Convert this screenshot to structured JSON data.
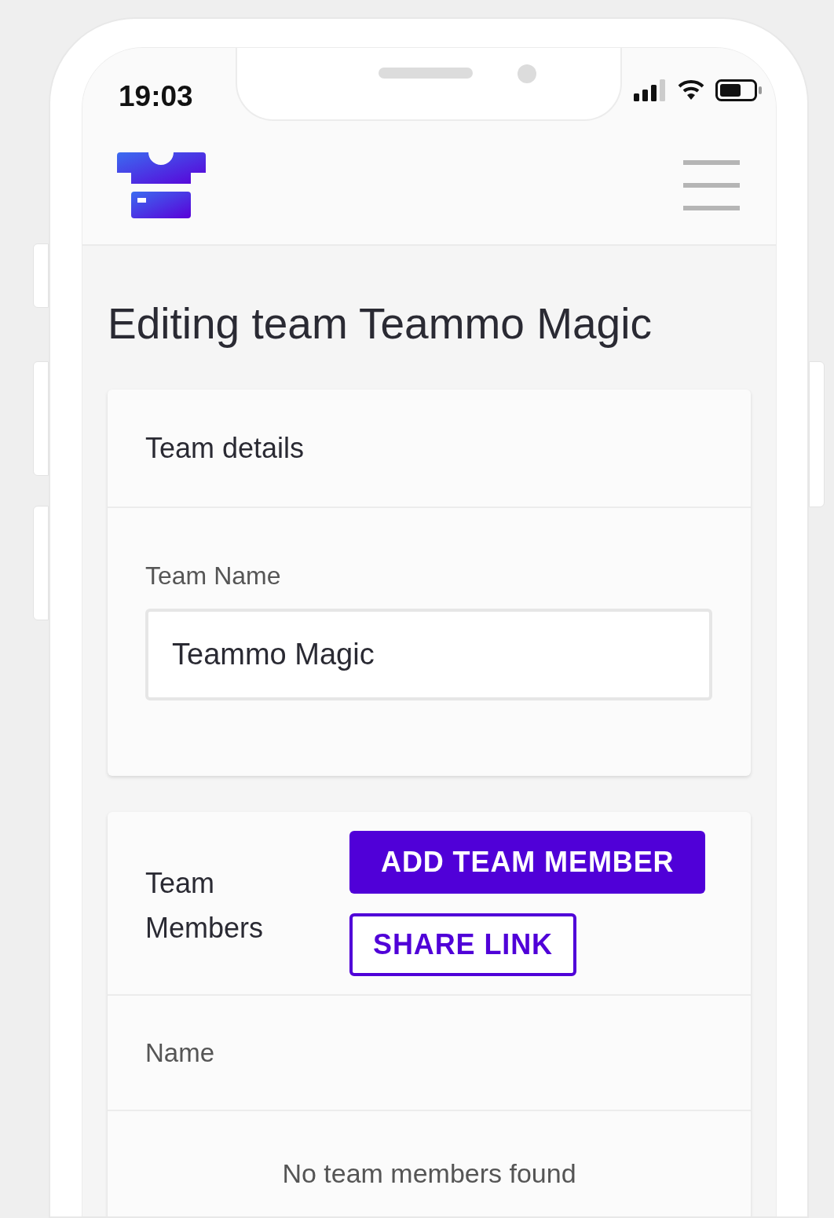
{
  "status_bar": {
    "time": "19:03"
  },
  "page_title": "Editing team Teammo Magic",
  "team_details": {
    "title": "Team details",
    "field": {
      "label": "Team Name",
      "value": "Teammo Magic"
    }
  },
  "team_members": {
    "title": "Team Members",
    "buttons": [
      {
        "label": "ADD TEAM MEMBER",
        "kind": "primary"
      },
      {
        "label": "SHARE LINK",
        "kind": "outline"
      }
    ],
    "table": {
      "columns": [
        "Name"
      ],
      "empty_message": "No team members found"
    }
  }
}
